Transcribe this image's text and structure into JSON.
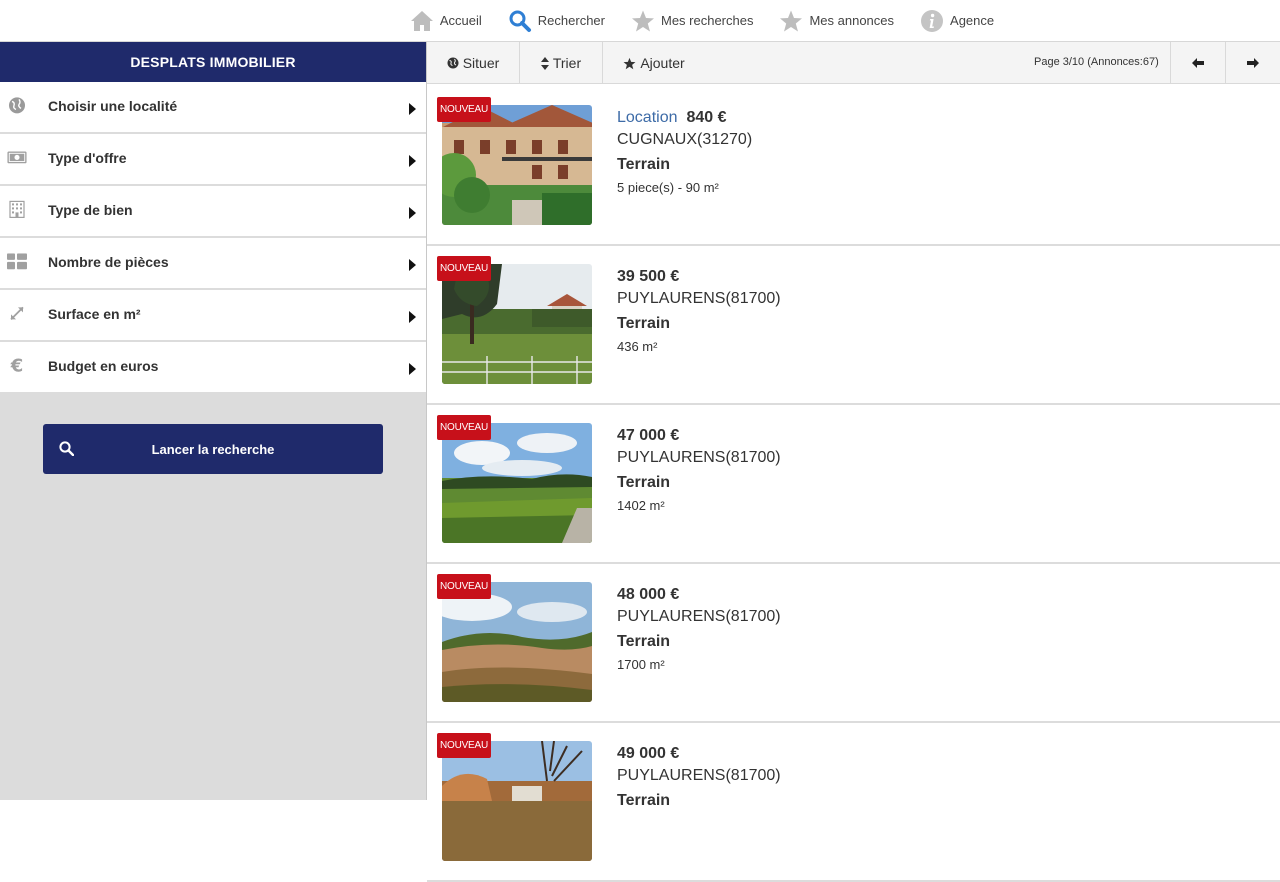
{
  "nav": {
    "items": [
      {
        "label": "Accueil",
        "icon": "home-icon"
      },
      {
        "label": "Rechercher",
        "icon": "search-icon"
      },
      {
        "label": "Mes recherches",
        "icon": "star-icon"
      },
      {
        "label": "Mes annonces",
        "icon": "star-icon"
      },
      {
        "label": "Agence",
        "icon": "info-icon"
      }
    ]
  },
  "sidebar": {
    "brand": "DESPLATS IMMOBILIER",
    "filters": [
      {
        "label": "Choisir une localité",
        "icon": "globe-icon"
      },
      {
        "label": "Type d'offre",
        "icon": "banknote-icon"
      },
      {
        "label": "Type de bien",
        "icon": "building-icon"
      },
      {
        "label": "Nombre de pièces",
        "icon": "grid-icon"
      },
      {
        "label": "Surface en m²",
        "icon": "expand-icon"
      },
      {
        "label": "Budget en euros",
        "icon": "euro-icon"
      }
    ],
    "search_button": "Lancer la recherche"
  },
  "toolbar": {
    "situer": "Situer",
    "trier": "Trier",
    "ajouter": "Ajouter",
    "page_info": "Page 3/10 (Annonces:67)"
  },
  "listings": [
    {
      "badge": "NOUVEAU",
      "type": "Location",
      "price": "840 €",
      "city": "CUGNAUX(31270)",
      "property": "Terrain",
      "detail": "5 piece(s) - 90 m²"
    },
    {
      "badge": "NOUVEAU",
      "type": "",
      "price": "39 500 €",
      "city": "PUYLAURENS(81700)",
      "property": "Terrain",
      "detail": "436 m²"
    },
    {
      "badge": "NOUVEAU",
      "type": "",
      "price": "47 000 €",
      "city": "PUYLAURENS(81700)",
      "property": "Terrain",
      "detail": "1402 m²"
    },
    {
      "badge": "NOUVEAU",
      "type": "",
      "price": "48 000 €",
      "city": "PUYLAURENS(81700)",
      "property": "Terrain",
      "detail": "1700 m²"
    },
    {
      "badge": "NOUVEAU",
      "type": "",
      "price": "49 000 €",
      "city": "PUYLAURENS(81700)",
      "property": "Terrain",
      "detail": ""
    }
  ],
  "colors": {
    "brand": "#1f2a6b",
    "badge": "#c7101a",
    "location_link": "#3d6ba7",
    "sidebar_bg": "#dcdcdc"
  }
}
